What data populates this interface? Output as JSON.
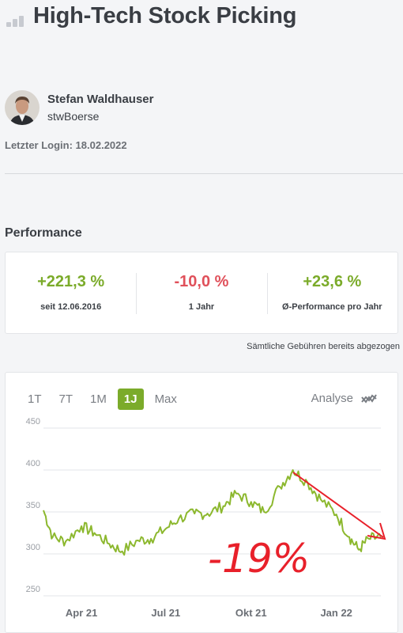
{
  "header": {
    "title": "High-Tech Stock Picking",
    "icon": "bar-chart-icon"
  },
  "profile": {
    "name": "Stefan Waldhauser",
    "handle": "stwBoerse"
  },
  "last_login": "Letzter Login: 18.02.2022",
  "performance": {
    "title": "Performance",
    "items": [
      {
        "value": "+221,3 %",
        "label": "seit 12.06.2016",
        "color": "#7bab2a"
      },
      {
        "value": "-10,0 %",
        "label": "1 Jahr",
        "color": "#e0505a"
      },
      {
        "value": "+23,6 %",
        "label": "Ø-Performance pro Jahr",
        "color": "#7bab2a"
      }
    ],
    "fee_note": "Sämtliche Gebühren bereits abgezogen"
  },
  "chart": {
    "tabs": [
      "1T",
      "7T",
      "1M",
      "1J",
      "Max"
    ],
    "active_tab": "1J",
    "analyse_label": "Analyse",
    "annotation": "-19%",
    "annotation_color": "#e8202a"
  },
  "chart_data": {
    "type": "line",
    "color": "#8cb82e",
    "ylim": [
      250,
      450
    ],
    "yticks": [
      250,
      300,
      350,
      400,
      450
    ],
    "xticks": [
      "Apr 21",
      "Jul 21",
      "Okt 21",
      "Jan 22"
    ],
    "x": [
      "2021-02-19",
      "2021-03-01",
      "2021-03-15",
      "2021-04-01",
      "2021-04-15",
      "2021-05-01",
      "2021-05-15",
      "2021-06-01",
      "2021-06-15",
      "2021-07-01",
      "2021-07-15",
      "2021-08-01",
      "2021-08-15",
      "2021-09-01",
      "2021-09-15",
      "2021-10-01",
      "2021-10-15",
      "2021-11-01",
      "2021-11-15",
      "2021-12-01",
      "2021-12-15",
      "2022-01-01",
      "2022-01-15",
      "2022-01-25",
      "2022-02-05",
      "2022-02-18"
    ],
    "series": [
      {
        "values": [
          352,
          320,
          315,
          333,
          325,
          312,
          303,
          316,
          318,
          330,
          342,
          348,
          348,
          357,
          372,
          362,
          350,
          380,
          400,
          385,
          365,
          347,
          320,
          305,
          318,
          320
        ]
      }
    ]
  }
}
